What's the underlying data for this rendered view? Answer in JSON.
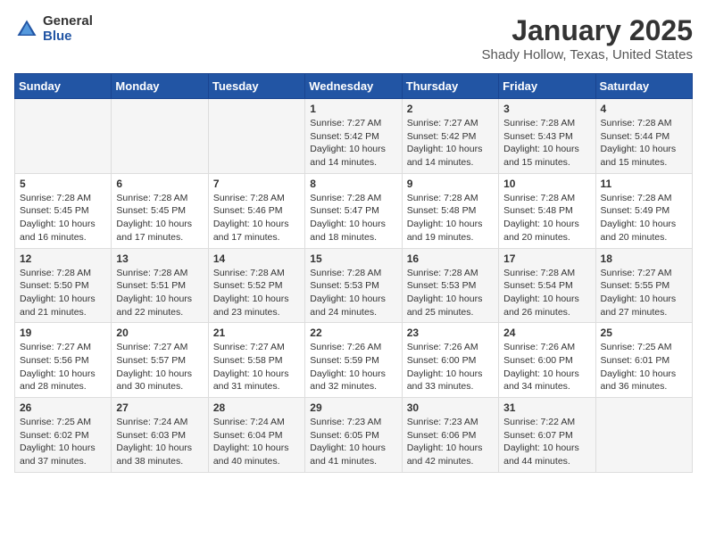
{
  "header": {
    "logo_general": "General",
    "logo_blue": "Blue",
    "title": "January 2025",
    "subtitle": "Shady Hollow, Texas, United States"
  },
  "days_of_week": [
    "Sunday",
    "Monday",
    "Tuesday",
    "Wednesday",
    "Thursday",
    "Friday",
    "Saturday"
  ],
  "weeks": [
    [
      {
        "day": "",
        "info": ""
      },
      {
        "day": "",
        "info": ""
      },
      {
        "day": "",
        "info": ""
      },
      {
        "day": "1",
        "info": "Sunrise: 7:27 AM\nSunset: 5:42 PM\nDaylight: 10 hours and 14 minutes."
      },
      {
        "day": "2",
        "info": "Sunrise: 7:27 AM\nSunset: 5:42 PM\nDaylight: 10 hours and 14 minutes."
      },
      {
        "day": "3",
        "info": "Sunrise: 7:28 AM\nSunset: 5:43 PM\nDaylight: 10 hours and 15 minutes."
      },
      {
        "day": "4",
        "info": "Sunrise: 7:28 AM\nSunset: 5:44 PM\nDaylight: 10 hours and 15 minutes."
      }
    ],
    [
      {
        "day": "5",
        "info": "Sunrise: 7:28 AM\nSunset: 5:45 PM\nDaylight: 10 hours and 16 minutes."
      },
      {
        "day": "6",
        "info": "Sunrise: 7:28 AM\nSunset: 5:45 PM\nDaylight: 10 hours and 17 minutes."
      },
      {
        "day": "7",
        "info": "Sunrise: 7:28 AM\nSunset: 5:46 PM\nDaylight: 10 hours and 17 minutes."
      },
      {
        "day": "8",
        "info": "Sunrise: 7:28 AM\nSunset: 5:47 PM\nDaylight: 10 hours and 18 minutes."
      },
      {
        "day": "9",
        "info": "Sunrise: 7:28 AM\nSunset: 5:48 PM\nDaylight: 10 hours and 19 minutes."
      },
      {
        "day": "10",
        "info": "Sunrise: 7:28 AM\nSunset: 5:48 PM\nDaylight: 10 hours and 20 minutes."
      },
      {
        "day": "11",
        "info": "Sunrise: 7:28 AM\nSunset: 5:49 PM\nDaylight: 10 hours and 20 minutes."
      }
    ],
    [
      {
        "day": "12",
        "info": "Sunrise: 7:28 AM\nSunset: 5:50 PM\nDaylight: 10 hours and 21 minutes."
      },
      {
        "day": "13",
        "info": "Sunrise: 7:28 AM\nSunset: 5:51 PM\nDaylight: 10 hours and 22 minutes."
      },
      {
        "day": "14",
        "info": "Sunrise: 7:28 AM\nSunset: 5:52 PM\nDaylight: 10 hours and 23 minutes."
      },
      {
        "day": "15",
        "info": "Sunrise: 7:28 AM\nSunset: 5:53 PM\nDaylight: 10 hours and 24 minutes."
      },
      {
        "day": "16",
        "info": "Sunrise: 7:28 AM\nSunset: 5:53 PM\nDaylight: 10 hours and 25 minutes."
      },
      {
        "day": "17",
        "info": "Sunrise: 7:28 AM\nSunset: 5:54 PM\nDaylight: 10 hours and 26 minutes."
      },
      {
        "day": "18",
        "info": "Sunrise: 7:27 AM\nSunset: 5:55 PM\nDaylight: 10 hours and 27 minutes."
      }
    ],
    [
      {
        "day": "19",
        "info": "Sunrise: 7:27 AM\nSunset: 5:56 PM\nDaylight: 10 hours and 28 minutes."
      },
      {
        "day": "20",
        "info": "Sunrise: 7:27 AM\nSunset: 5:57 PM\nDaylight: 10 hours and 30 minutes."
      },
      {
        "day": "21",
        "info": "Sunrise: 7:27 AM\nSunset: 5:58 PM\nDaylight: 10 hours and 31 minutes."
      },
      {
        "day": "22",
        "info": "Sunrise: 7:26 AM\nSunset: 5:59 PM\nDaylight: 10 hours and 32 minutes."
      },
      {
        "day": "23",
        "info": "Sunrise: 7:26 AM\nSunset: 6:00 PM\nDaylight: 10 hours and 33 minutes."
      },
      {
        "day": "24",
        "info": "Sunrise: 7:26 AM\nSunset: 6:00 PM\nDaylight: 10 hours and 34 minutes."
      },
      {
        "day": "25",
        "info": "Sunrise: 7:25 AM\nSunset: 6:01 PM\nDaylight: 10 hours and 36 minutes."
      }
    ],
    [
      {
        "day": "26",
        "info": "Sunrise: 7:25 AM\nSunset: 6:02 PM\nDaylight: 10 hours and 37 minutes."
      },
      {
        "day": "27",
        "info": "Sunrise: 7:24 AM\nSunset: 6:03 PM\nDaylight: 10 hours and 38 minutes."
      },
      {
        "day": "28",
        "info": "Sunrise: 7:24 AM\nSunset: 6:04 PM\nDaylight: 10 hours and 40 minutes."
      },
      {
        "day": "29",
        "info": "Sunrise: 7:23 AM\nSunset: 6:05 PM\nDaylight: 10 hours and 41 minutes."
      },
      {
        "day": "30",
        "info": "Sunrise: 7:23 AM\nSunset: 6:06 PM\nDaylight: 10 hours and 42 minutes."
      },
      {
        "day": "31",
        "info": "Sunrise: 7:22 AM\nSunset: 6:07 PM\nDaylight: 10 hours and 44 minutes."
      },
      {
        "day": "",
        "info": ""
      }
    ]
  ]
}
